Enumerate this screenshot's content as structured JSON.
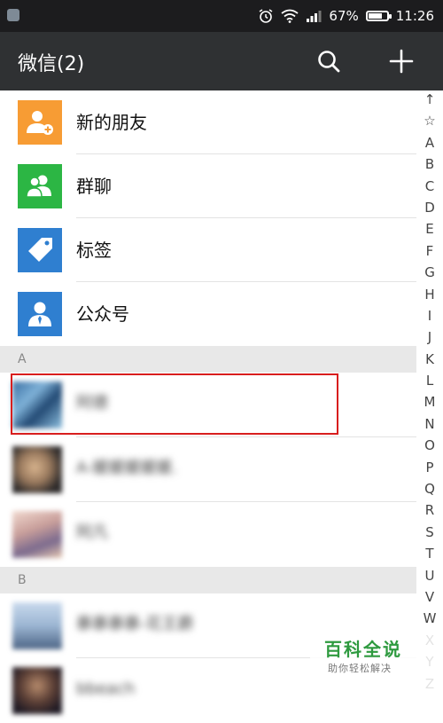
{
  "status_bar": {
    "battery_percent": "67%",
    "battery_level": 0.67,
    "time": "11:26"
  },
  "header": {
    "title": "微信(2)",
    "search_icon": "search-icon",
    "add_icon": "plus-icon"
  },
  "features": [
    {
      "label": "新的朋友",
      "icon": "new-friend-icon",
      "color": "#f79c34"
    },
    {
      "label": "群聊",
      "icon": "group-chat-icon",
      "color": "#2cb644"
    },
    {
      "label": "标签",
      "icon": "tag-icon",
      "color": "#2f7fd0"
    },
    {
      "label": "公众号",
      "icon": "official-account-icon",
      "color": "#2f7fd0"
    }
  ],
  "sections": [
    {
      "letter": "A",
      "contacts": [
        {
          "name": "阿德"
        },
        {
          "name": "A-媛媛媛媛媛."
        },
        {
          "name": "阿凡"
        }
      ]
    },
    {
      "letter": "B",
      "contacts": [
        {
          "name": "暴暴暴暴-花王爵"
        },
        {
          "name": "bbeach"
        }
      ]
    }
  ],
  "index_letters": [
    "↑",
    "☆",
    "A",
    "B",
    "C",
    "D",
    "E",
    "F",
    "G",
    "H",
    "I",
    "J",
    "K",
    "L",
    "M",
    "N",
    "O",
    "P",
    "Q",
    "R",
    "S",
    "T",
    "U",
    "V",
    "W",
    "X",
    "Y",
    "Z"
  ],
  "watermark": {
    "title": "百科全说",
    "subtitle": "助你轻松解决"
  },
  "colors": {
    "navbar": "#2f3133",
    "statusbar": "#1c1c1e",
    "highlight": "#d81e1e",
    "brand_green": "#2e9a3f"
  }
}
